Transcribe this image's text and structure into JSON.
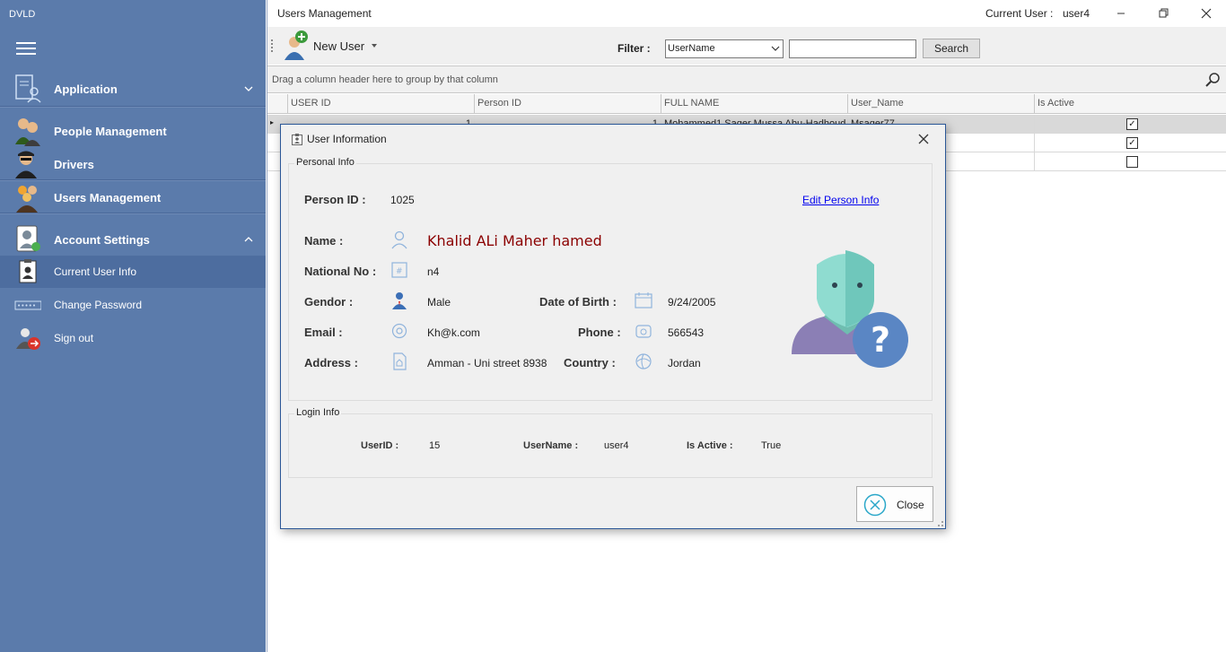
{
  "app": {
    "title": "DVLD"
  },
  "sidebar": {
    "groups": [
      {
        "label": "Application",
        "icon": "document-user-icon",
        "expanded": false
      },
      {
        "label": "People Management",
        "icon": "people-icon"
      },
      {
        "label": "Drivers",
        "icon": "driver-icon"
      },
      {
        "label": "Users Management",
        "icon": "users-group-icon"
      },
      {
        "label": "Account Settings",
        "icon": "account-settings-icon",
        "expanded": true
      }
    ],
    "sub_items": [
      {
        "label": "Current User Info",
        "icon": "user-badge-icon",
        "active": true
      },
      {
        "label": "Change Password",
        "icon": "password-icon"
      },
      {
        "label": "Sign out",
        "icon": "sign-out-icon"
      }
    ]
  },
  "window": {
    "title": "Users Management",
    "current_user_label": "Current User :",
    "current_user": "user4"
  },
  "toolbar": {
    "new_user_label": "New User",
    "filter_label": "Filter :",
    "filter_selected": "UserName",
    "filter_value": "",
    "search_label": "Search"
  },
  "grid": {
    "group_hint": "Drag a column header here to group by that column",
    "columns": [
      "USER ID",
      "Person ID",
      "FULL NAME",
      "User_Name",
      "Is Active"
    ],
    "rows": [
      {
        "user_id": "1",
        "person_id": "1",
        "full_name": "Mohammed1 Saqer Mussa Abu-Hadhoud",
        "user_name": "Msaqer77",
        "is_active": true
      },
      {
        "user_id": "",
        "person_id": "",
        "full_name": "",
        "user_name": "",
        "is_active": true
      },
      {
        "user_id": "",
        "person_id": "",
        "full_name": "",
        "user_name": "",
        "is_active": false
      }
    ]
  },
  "dialog": {
    "title": "User Information",
    "personal_info": {
      "group_title": "Personal Info",
      "person_id_label": "Person ID :",
      "person_id": "1025",
      "edit_link": "Edit Person Info",
      "name_label": "Name :",
      "name": "Khalid ALi Maher hamed",
      "national_no_label": "National No :",
      "national_no": "n4",
      "gender_label": "Gendor :",
      "gender": "Male",
      "dob_label": "Date of Birth :",
      "dob": "9/24/2005",
      "email_label": "Email :",
      "email": "Kh@k.com",
      "phone_label": "Phone :",
      "phone": "566543",
      "address_label": "Address :",
      "address": "Amman - Uni street 8938",
      "country_label": "Country :",
      "country": "Jordan"
    },
    "login_info": {
      "group_title": "Login Info",
      "user_id_label": "UserID :",
      "user_id": "15",
      "username_label": "UserName :",
      "username": "user4",
      "is_active_label": "Is Active :",
      "is_active": "True"
    },
    "close_label": "Close"
  },
  "colors": {
    "sidebar_bg": "#5b7bab",
    "name_text": "#8b0000",
    "link": "#0000ee",
    "dialog_border": "#2b5797"
  }
}
